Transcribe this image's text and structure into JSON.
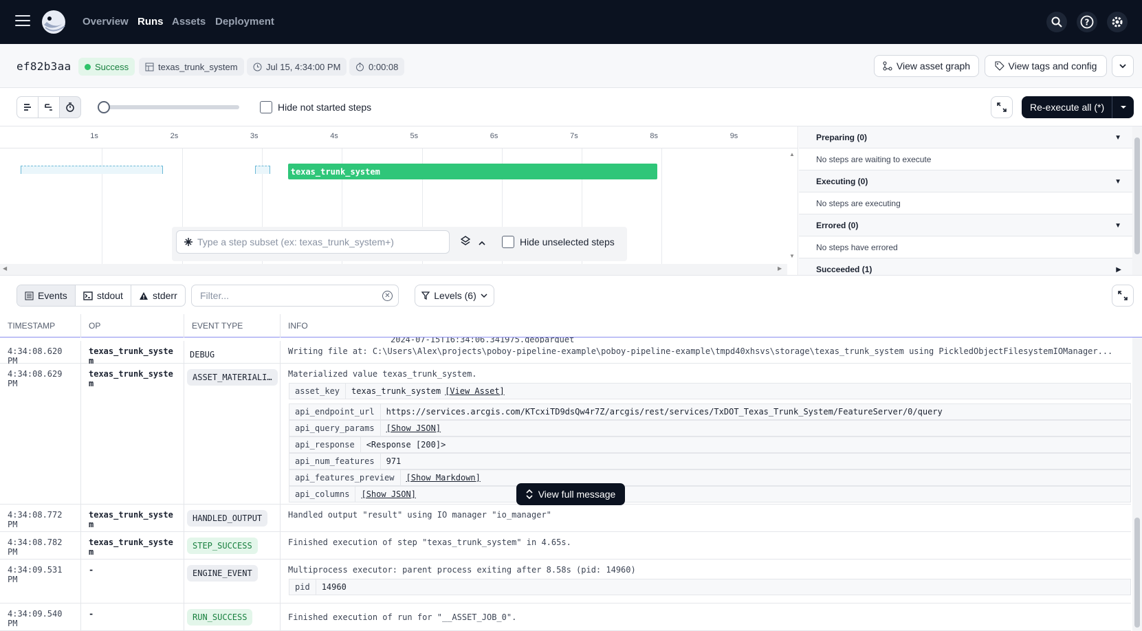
{
  "nav": {
    "links": [
      "Overview",
      "Runs",
      "Assets",
      "Deployment"
    ],
    "active": "Runs"
  },
  "run": {
    "id": "ef82b3aa",
    "status": "Success",
    "job": "texas_trunk_system",
    "started": "Jul 15, 4:34:00 PM",
    "duration": "0:00:08"
  },
  "actions": {
    "view_asset_graph": "View asset graph",
    "view_tags": "View tags and config"
  },
  "toolbar": {
    "hide_not_started": "Hide not started steps",
    "reexecute": "Re-execute all (*)"
  },
  "gantt": {
    "ticks": [
      "1s",
      "2s",
      "3s",
      "4s",
      "5s",
      "6s",
      "7s",
      "8s",
      "9s"
    ],
    "step_name": "texas_trunk_system",
    "step_start_s": 3.3,
    "step_end_s": 8.0,
    "subset_placeholder": "Type a step subset (ex: texas_trunk_system+)",
    "hide_unselected": "Hide unselected steps"
  },
  "side": [
    {
      "title": "Preparing (0)",
      "body": "No steps are waiting to execute",
      "expanded": true
    },
    {
      "title": "Executing (0)",
      "body": "No steps are executing",
      "expanded": true
    },
    {
      "title": "Errored (0)",
      "body": "No steps have errored",
      "expanded": true
    },
    {
      "title": "Succeeded (1)",
      "body": "",
      "expanded": false
    }
  ],
  "logs": {
    "tabs": [
      "Events",
      "stdout",
      "stderr"
    ],
    "filter_placeholder": "Filter...",
    "levels": "Levels (6)",
    "columns": [
      "TIMESTAMP",
      "OP",
      "EVENT TYPE",
      "INFO"
    ],
    "partial_text": "2024-07-15T16:34:06.341975.geoparquet",
    "rows": [
      {
        "ts": "4:34:08.620 PM",
        "op": "texas_trunk_system",
        "type": "DEBUG",
        "info": "Writing file at: C:\\Users\\Alex\\projects\\poboy-pipeline-example\\poboy-pipeline-example\\tmpd40xhsvs\\storage\\texas_trunk_system using PickledObjectFilesystemIOManager..."
      },
      {
        "ts": "4:34:08.629 PM",
        "op": "texas_trunk_system",
        "type": "ASSET_MATERIALI…",
        "info": "Materialized value texas_trunk_system."
      },
      {
        "ts": "4:34:08.772 PM",
        "op": "texas_trunk_system",
        "type": "HANDLED_OUTPUT",
        "info": "Handled output \"result\" using IO manager \"io_manager\""
      },
      {
        "ts": "4:34:08.782 PM",
        "op": "texas_trunk_system",
        "type": "STEP_SUCCESS",
        "info": "Finished execution of step \"texas_trunk_system\" in 4.65s."
      },
      {
        "ts": "4:34:09.531 PM",
        "op": "-",
        "type": "ENGINE_EVENT",
        "info": "Multiprocess executor: parent process exiting after 8.58s (pid: 14960)"
      },
      {
        "ts": "4:34:09.540 PM",
        "op": "-",
        "type": "RUN_SUCCESS",
        "info": "Finished execution of run for \"__ASSET_JOB_0\"."
      }
    ],
    "asset_key": {
      "k": "asset_key",
      "v": "texas_trunk_system",
      "link": "[View Asset]"
    },
    "metadata": [
      {
        "k": "api_endpoint_url",
        "v": "https://services.arcgis.com/KTcxiTD9dsQw4r7Z/arcgis/rest/services/TxDOT_Texas_Trunk_System/FeatureServer/0/query"
      },
      {
        "k": "api_query_params",
        "v": "[Show JSON]"
      },
      {
        "k": "api_response",
        "v": "<Response [200]>"
      },
      {
        "k": "api_num_features",
        "v": "971"
      },
      {
        "k": "api_features_preview",
        "v": "[Show Markdown]"
      },
      {
        "k": "api_columns",
        "v": "[Show JSON]"
      }
    ],
    "pid": {
      "k": "pid",
      "v": "14960"
    },
    "view_full": "View full message"
  },
  "colors": {
    "nav_bg": "#0b1220",
    "success": "#2fc36a",
    "accent": "#8a8df0"
  }
}
